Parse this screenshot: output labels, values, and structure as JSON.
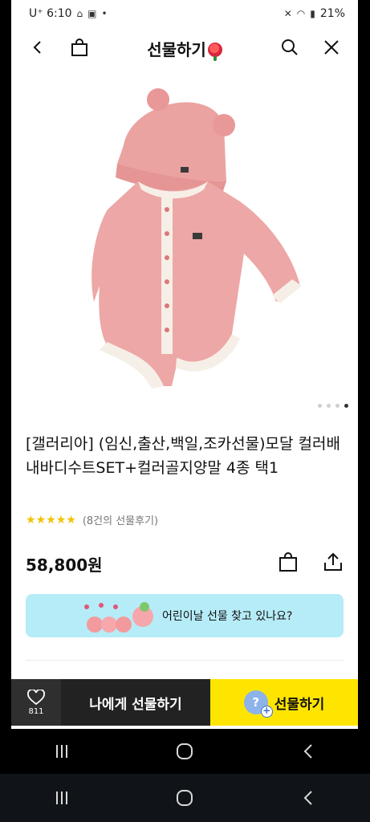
{
  "status_bar": {
    "carrier_time": "U⁺ 6:10",
    "battery": "21%"
  },
  "header": {
    "title": "선물하기"
  },
  "product": {
    "name": "[갤러리아] (임신,출산,백일,조카선물)모달 컬러배내바디수트SET+컬러골지양말 4종 택1",
    "rating_stars": 5,
    "review_count": "(8건의 선물후기)",
    "price": "58,800원",
    "image_pages": 4,
    "image_active_index": 3
  },
  "banner": {
    "text": "어린이날 선물 찾고 있나요?"
  },
  "bottom_bar": {
    "like_count": "811",
    "gift_self_label": "나에게 선물하기",
    "gift_label": "선물하기"
  },
  "colors": {
    "accent_yellow": "#fee500",
    "banner_bg": "#b6ecf7",
    "dark_bar": "#222222",
    "star": "#f2c200"
  },
  "icons": [
    "back-icon",
    "shopping-bag-icon",
    "search-icon",
    "close-icon",
    "heart-icon",
    "share-icon",
    "recents-icon",
    "home-icon",
    "system-back-icon"
  ]
}
